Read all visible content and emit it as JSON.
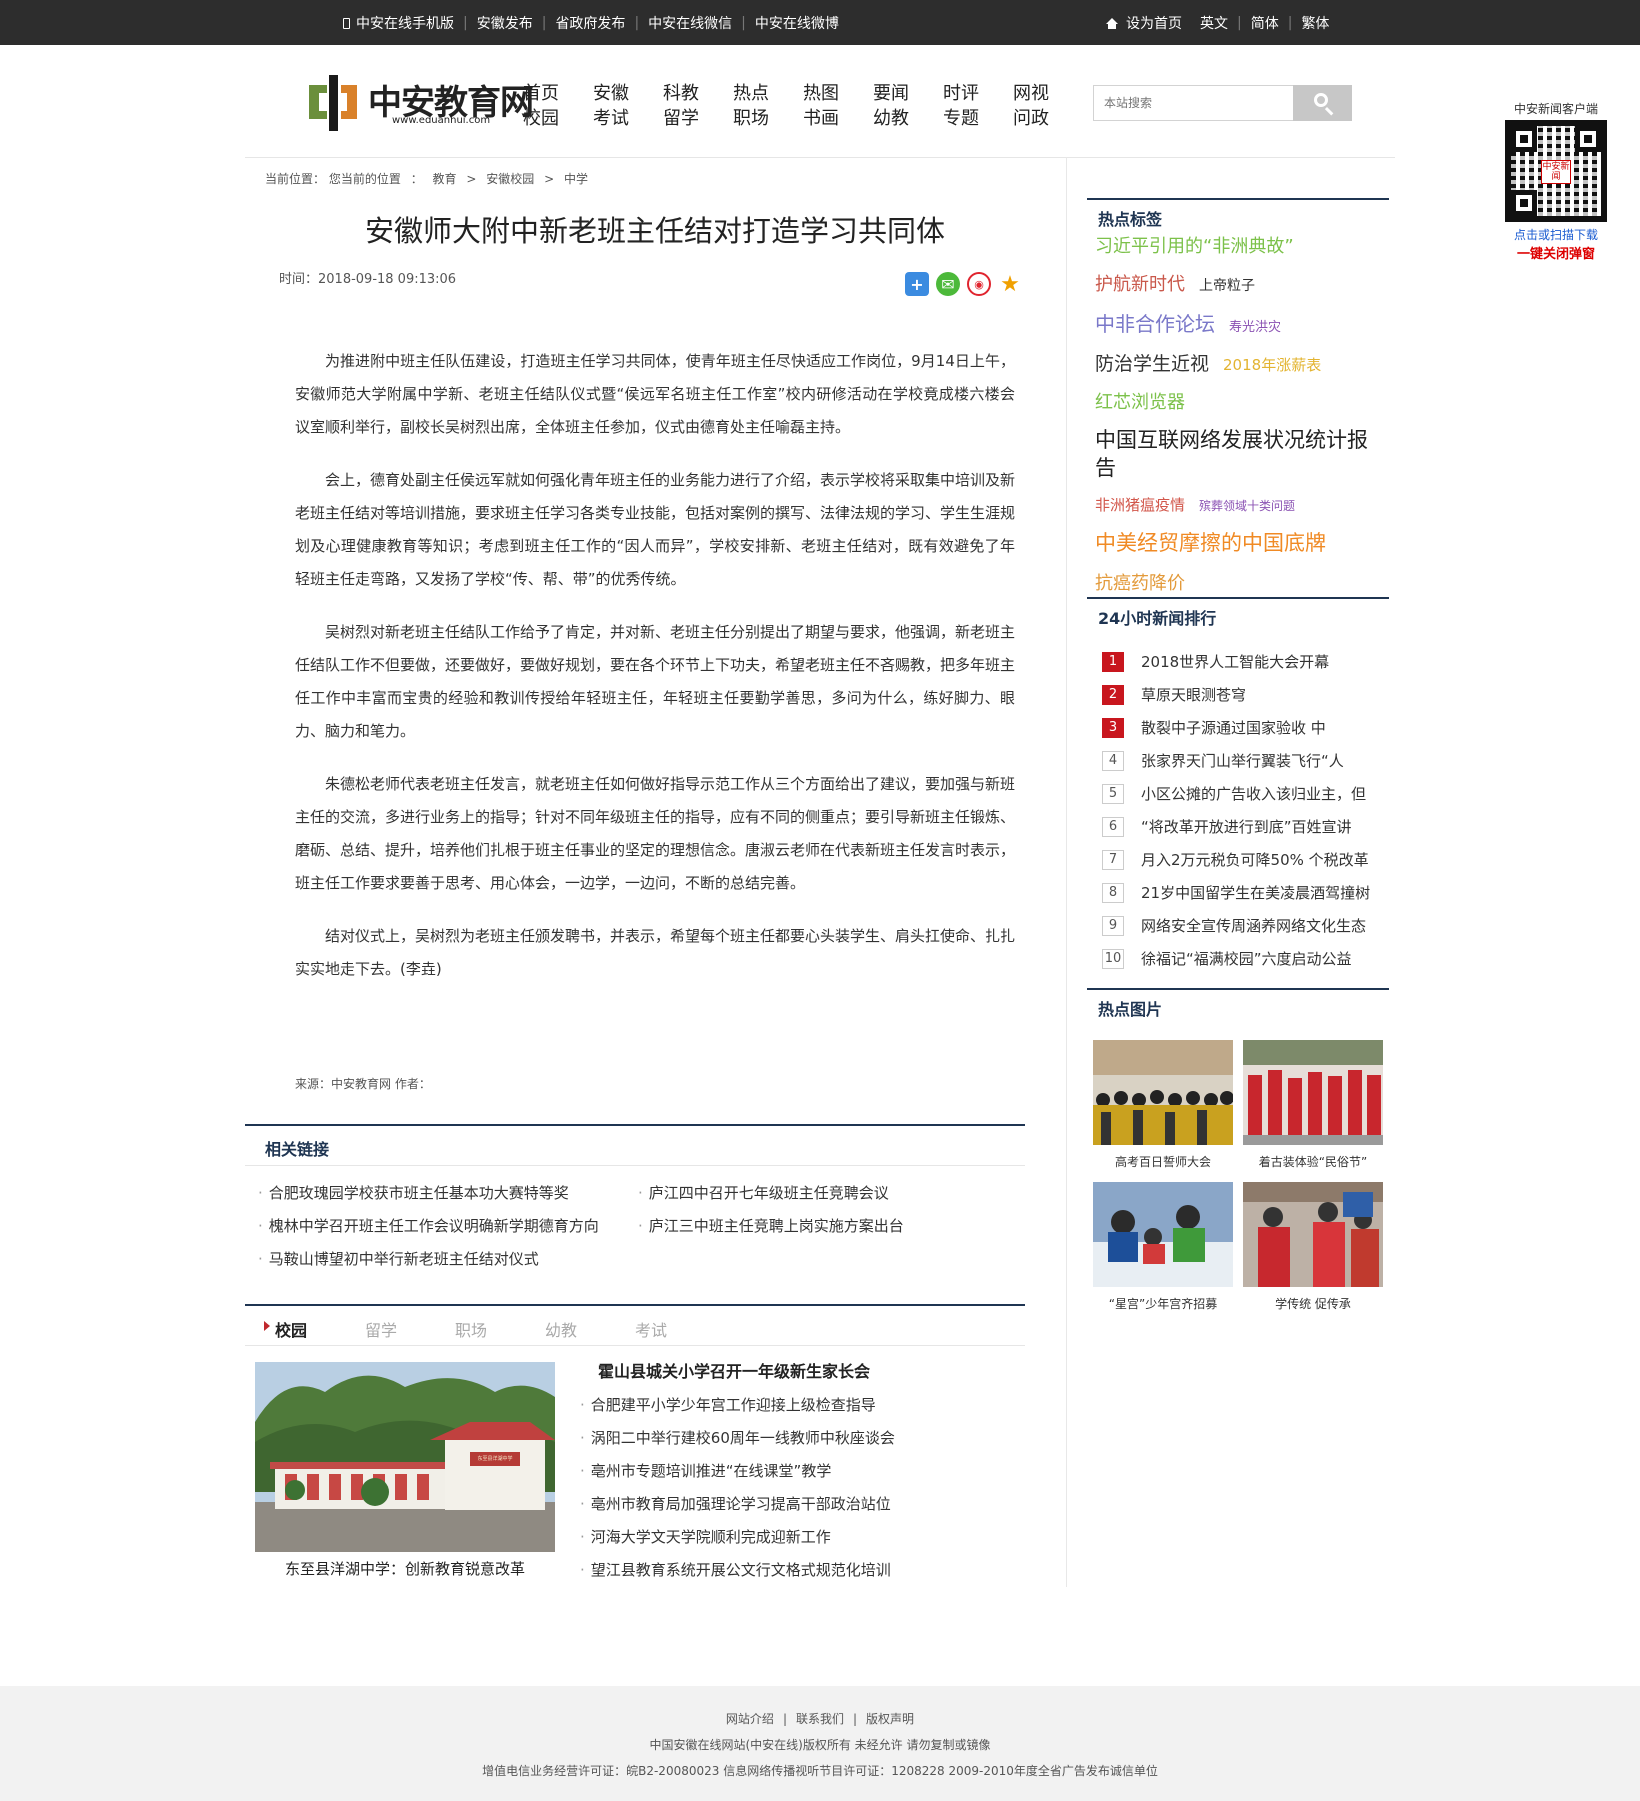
{
  "topbar": {
    "left_links": [
      "中安在线手机版",
      "安徽发布",
      "省政府发布",
      "中安在线微信",
      "中安在线微博"
    ],
    "right_links": [
      "设为首页",
      "英文",
      "简体",
      "繁体"
    ]
  },
  "logo": {
    "text": "中安教育网",
    "url": "www.eduanhui.com"
  },
  "nav": [
    [
      "首页",
      "校园"
    ],
    [
      "安徽",
      "考试"
    ],
    [
      "科教",
      "留学"
    ],
    [
      "热点",
      "职场"
    ],
    [
      "热图",
      "书画"
    ],
    [
      "要闻",
      "幼教"
    ],
    [
      "时评",
      "专题"
    ],
    [
      "网视",
      "问政"
    ]
  ],
  "search": {
    "placeholder": "本站搜索"
  },
  "qr": {
    "caption": "中安新闻客户端",
    "center": "中安新闻",
    "scan": "点击或扫描下载",
    "close": "一键关闭弹窗"
  },
  "breadcrumb": {
    "label": "当前位置：",
    "items": [
      "您当前的位置",
      "教育",
      "安徽校园",
      "中学"
    ],
    "sep1": "：",
    "sep": ">"
  },
  "article": {
    "title": "安徽师大附中新老班主任结对打造学习共同体",
    "time": "时间：2018-09-18 09:13:06",
    "paragraphs": [
      "为推进附中班主任队伍建设，打造班主任学习共同体，使青年班主任尽快适应工作岗位，9月14日上午，安徽师范大学附属中学新、老班主任结队仪式暨“侯远军名班主任工作室”校内研修活动在学校竟成楼六楼会议室顺利举行，副校长吴树烈出席，全体班主任参加，仪式由德育处主任喻磊主持。",
      "会上，德育处副主任侯远军就如何强化青年班主任的业务能力进行了介绍，表示学校将采取集中培训及新老班主任结对等培训措施，要求班主任学习各类专业技能，包括对案例的撰写、法律法规的学习、学生生涯规划及心理健康教育等知识；考虑到班主任工作的“因人而异”，学校安排新、老班主任结对，既有效避免了年轻班主任走弯路，又发扬了学校“传、帮、带”的优秀传统。",
      "吴树烈对新老班主任结队工作给予了肯定，并对新、老班主任分别提出了期望与要求，他强调，新老班主任结队工作不但要做，还要做好，要做好规划，要在各个环节上下功夫，希望老班主任不吝赐教，把多年班主任工作中丰富而宝贵的经验和教训传授给年轻班主任，年轻班主任要勤学善思，多问为什么，练好脚力、眼力、脑力和笔力。",
      "朱德松老师代表老班主任发言，就老班主任如何做好指导示范工作从三个方面给出了建议，要加强与新班主任的交流，多进行业务上的指导；针对不同年级班主任的指导，应有不同的侧重点；要引导新班主任锻炼、磨砺、总结、提升，培养他们扎根于班主任事业的坚定的理想信念。唐淑云老师在代表新班主任发言时表示，班主任工作要求要善于思考、用心体会，一边学，一边问，不断的总结完善。",
      "结对仪式上，吴树烈为老班主任颁发聘书，并表示，希望每个班主任都要心头装学生、肩头扛使命、扎扎实实地走下去。(李垚)"
    ],
    "source": "来源：中安教育网   作者："
  },
  "related": {
    "title": "相关链接",
    "items": [
      "合肥玫瑰园学校获市班主任基本功大赛特等奖",
      "庐江四中召开七年级班主任竞聘会议",
      "槐林中学召开班主任工作会议明确新学期德育方向",
      "庐江三中班主任竞聘上岗实施方案出台",
      "马鞍山博望初中举行新老班主任结对仪式"
    ]
  },
  "tabs": [
    "校园",
    "留学",
    "职场",
    "幼教",
    "考试"
  ],
  "campus": {
    "image_caption": "东至县洋湖中学：创新教育锐意改革",
    "sign_text": "东至县洋湖中学",
    "lead": "霍山县城关小学召开一年级新生家长会",
    "items": [
      "合肥建平小学少年宫工作迎接上级检查指导",
      "涡阳二中举行建校60周年一线教师中秋座谈会",
      "亳州市专题培训推进“在线课堂”教学",
      "亳州市教育局加强理论学习提高干部政治站位",
      "河海大学文天学院顺利完成迎新工作",
      "望江县教育系统开展公文行文格式规范化培训"
    ]
  },
  "hot_tags": {
    "title": "热点标签",
    "rows": [
      [
        {
          "text": "习近平引用的“非洲典故”",
          "color": "#7cc14a",
          "size": 18
        }
      ],
      [
        {
          "text": "护航新时代",
          "color": "#c9584b",
          "size": 18
        },
        {
          "text": "上帝粒子",
          "color": "#333333",
          "size": 14
        }
      ],
      [
        {
          "text": "中非合作论坛",
          "color": "#7a78c9",
          "size": 20
        },
        {
          "text": "寿光洪灾",
          "color": "#8b52b3",
          "size": 13
        }
      ],
      [
        {
          "text": "防治学生近视",
          "color": "#333333",
          "size": 19
        },
        {
          "text": "2018年涨薪表",
          "color": "#e3b431",
          "size": 15
        }
      ],
      [
        {
          "text": "红芯浏览器",
          "color": "#7cc14a",
          "size": 18
        }
      ],
      [
        {
          "text": "中国互联网络发展状况统计报告",
          "color": "#222222",
          "size": 21
        }
      ],
      [
        {
          "text": "非洲猪瘟疫情",
          "color": "#d2574b",
          "size": 15
        },
        {
          "text": "殡葬领域十类问题",
          "color": "#8b52b3",
          "size": 12
        }
      ],
      [
        {
          "text": "中美经贸摩擦的中国底牌",
          "color": "#f08a24",
          "size": 21
        }
      ],
      [
        {
          "text": "抗癌药降价",
          "color": "#e39a3a",
          "size": 18
        }
      ]
    ]
  },
  "ranking": {
    "title": "24小时新闻排行",
    "items": [
      {
        "n": "1",
        "text": "2018世界人工智能大会开幕"
      },
      {
        "n": "2",
        "text": "草原天眼测苍穹"
      },
      {
        "n": "3",
        "text": "散裂中子源通过国家验收 中"
      },
      {
        "n": "4",
        "text": "张家界天门山举行翼装飞行“人"
      },
      {
        "n": "5",
        "text": "小区公摊的广告收入该归业主，但"
      },
      {
        "n": "6",
        "text": "“将改革开放进行到底”百姓宣讲"
      },
      {
        "n": "7",
        "text": "月入2万元税负可降50% 个税改革"
      },
      {
        "n": "8",
        "text": "21岁中国留学生在美凌晨酒驾撞树"
      },
      {
        "n": "9",
        "text": "网络安全宣传周涵养网络文化生态"
      },
      {
        "n": "10",
        "text": "徐福记“福满校园”六度启动公益"
      }
    ]
  },
  "hot_pics": {
    "title": "热点图片",
    "items": [
      "高考百日誓师大会",
      "着古装体验“民俗节”",
      "“星宫”少年宫齐招募",
      "学传统 促传承"
    ]
  },
  "footer": {
    "links": [
      "网站介绍",
      "联系我们",
      "版权声明"
    ],
    "line2": "中国安徽在线网站(中安在线)版权所有 未经允许 请勿复制或镜像",
    "line3": "增值电信业务经营许可证：皖B2-20080023 信息网络传播视听节目许可证：1208228   2009-2010年度全省广告发布诚信单位"
  }
}
